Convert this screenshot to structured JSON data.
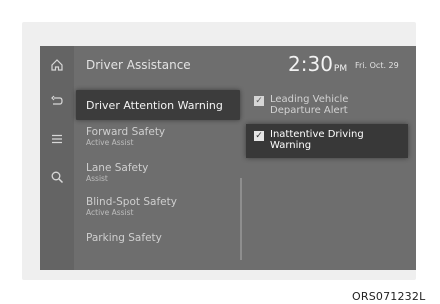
{
  "header": {
    "title": "Driver Assistance",
    "time": "2:30",
    "ampm": "PM",
    "date": "Fri. Oct. 29"
  },
  "sidebar": {
    "icons": [
      "home-icon",
      "back-icon",
      "menu-icon",
      "search-icon"
    ]
  },
  "menu": {
    "selected": "Driver Attention Warning",
    "items": [
      {
        "label": "Forward Safety",
        "sub": "Active Assist"
      },
      {
        "label": "Lane Safety",
        "sub": "Assist"
      },
      {
        "label": "Blind-Spot Safety",
        "sub": "Active Assist"
      },
      {
        "label": "Parking Safety",
        "sub": ""
      }
    ]
  },
  "options": [
    {
      "label": "Leading Vehicle Departure Alert",
      "line1": "Leading Vehicle",
      "line2": "Departure Alert",
      "checked": true
    },
    {
      "label": "Inattentive Driving Warning",
      "line1": "Inattentive Driving",
      "line2": "Warning",
      "checked": true
    }
  ],
  "figure_code": "ORS071232L"
}
